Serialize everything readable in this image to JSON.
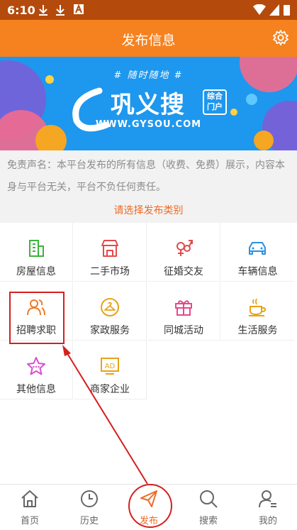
{
  "status_bar": {
    "time": "6:10"
  },
  "header": {
    "title": "发布信息"
  },
  "banner": {
    "slogan": "# 随时随地 #",
    "brand": "巩义搜",
    "badge": "综合门户",
    "url": "WWW.GYSOU.COM"
  },
  "notice": {
    "text": "免责声名：本平台发布的所有信息（收费、免费）展示，内容本身与平台无关，平台不负任何责任。",
    "choose": "请选择发布类别"
  },
  "categories": [
    {
      "label": "房屋信息",
      "icon": "building-icon",
      "color": "#3cb23c"
    },
    {
      "label": "二手市场",
      "icon": "shop-icon",
      "color": "#e24a4a"
    },
    {
      "label": "征婚交友",
      "icon": "gender-icon",
      "color": "#e24a4a"
    },
    {
      "label": "车辆信息",
      "icon": "car-icon",
      "color": "#2a90e0"
    },
    {
      "label": "招聘求职",
      "icon": "people-icon",
      "color": "#ef7b2a"
    },
    {
      "label": "家政服务",
      "icon": "hanger-icon",
      "color": "#e6a319"
    },
    {
      "label": "同城活动",
      "icon": "gift-icon",
      "color": "#e24a8c"
    },
    {
      "label": "生活服务",
      "icon": "coffee-icon",
      "color": "#e6a319"
    },
    {
      "label": "其他信息",
      "icon": "star-icon",
      "color": "#d94fcf"
    },
    {
      "label": "商家企业",
      "icon": "ad-icon",
      "color": "#e6a319"
    }
  ],
  "tabs": [
    {
      "label": "首页",
      "icon": "home-icon"
    },
    {
      "label": "历史",
      "icon": "clock-icon"
    },
    {
      "label": "发布",
      "icon": "send-icon",
      "active": true
    },
    {
      "label": "搜索",
      "icon": "search-icon"
    },
    {
      "label": "我的",
      "icon": "user-icon"
    }
  ],
  "colors": {
    "header": "#f6821f",
    "status_bar": "#b44b0c",
    "banner": "#1e97ee",
    "accent": "#ef6a24",
    "annotation": "#d51f1f"
  }
}
